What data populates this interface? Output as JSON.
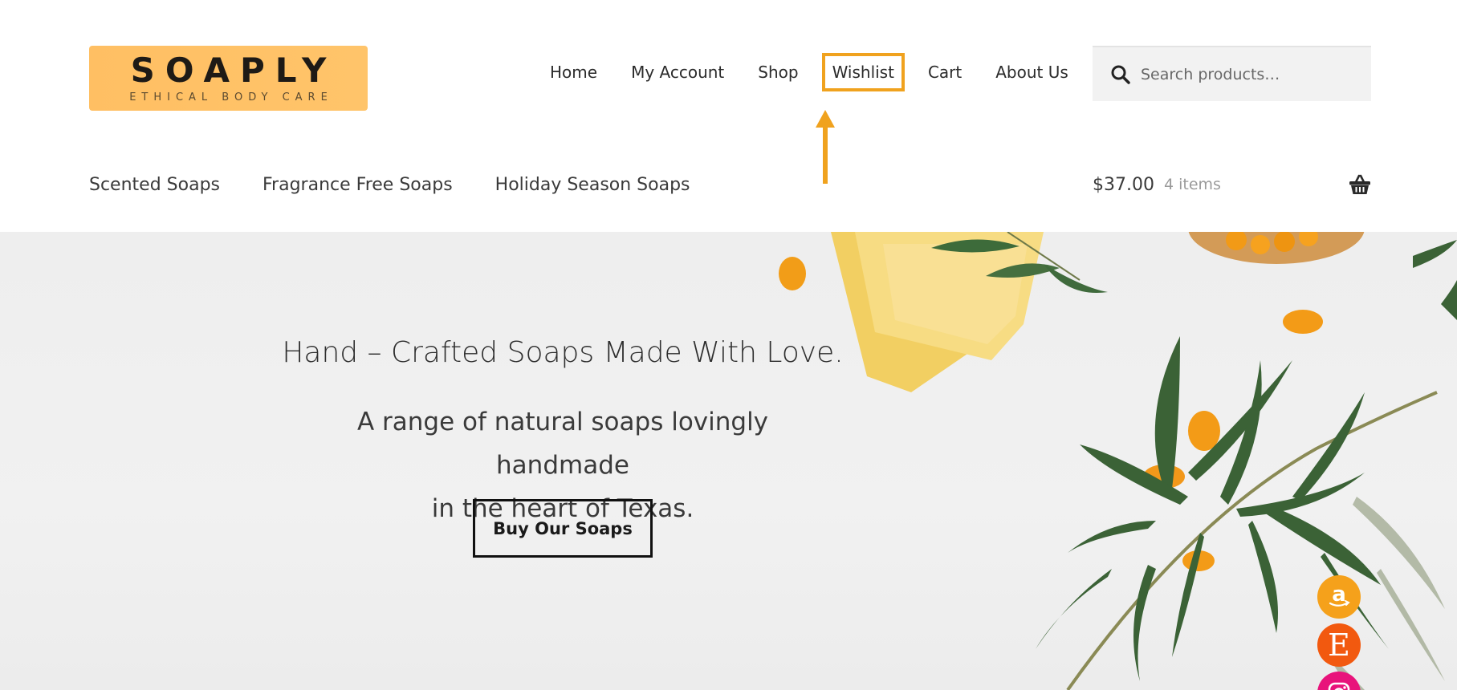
{
  "site": {
    "logo_text": "SOAPLY",
    "logo_tagline": "ETHICAL BODY CARE"
  },
  "primary_nav": {
    "items": [
      {
        "label": "Home"
      },
      {
        "label": "My Account"
      },
      {
        "label": "Shop"
      },
      {
        "label": "Wishlist",
        "highlighted": true
      },
      {
        "label": "Cart"
      },
      {
        "label": "About Us"
      }
    ]
  },
  "search": {
    "placeholder": "Search products…",
    "icon": "search-icon"
  },
  "secondary_nav": {
    "items": [
      {
        "label": "Scented Soaps"
      },
      {
        "label": "Fragrance Free Soaps"
      },
      {
        "label": "Holiday Season Soaps"
      }
    ]
  },
  "cart": {
    "amount": "$37.00",
    "count_label": "4 items",
    "icon": "basket-icon"
  },
  "hero": {
    "title": "Hand – Crafted Soaps Made With Love.",
    "subtitle_line1": "A range of natural soaps lovingly handmade",
    "subtitle_line2": "in the heart of Texas.",
    "button_label": "Buy Our Soaps"
  },
  "social": {
    "links": [
      {
        "icon": "amazon-icon",
        "color": "#f5a11b"
      },
      {
        "icon": "etsy-icon",
        "color": "#f2590f",
        "glyph": "E"
      },
      {
        "icon": "instagram-icon",
        "color": "#e8137b"
      }
    ]
  },
  "colors": {
    "logo_bg": "#ffbf63",
    "annotation": "#f0a21e",
    "text": "#333333"
  }
}
